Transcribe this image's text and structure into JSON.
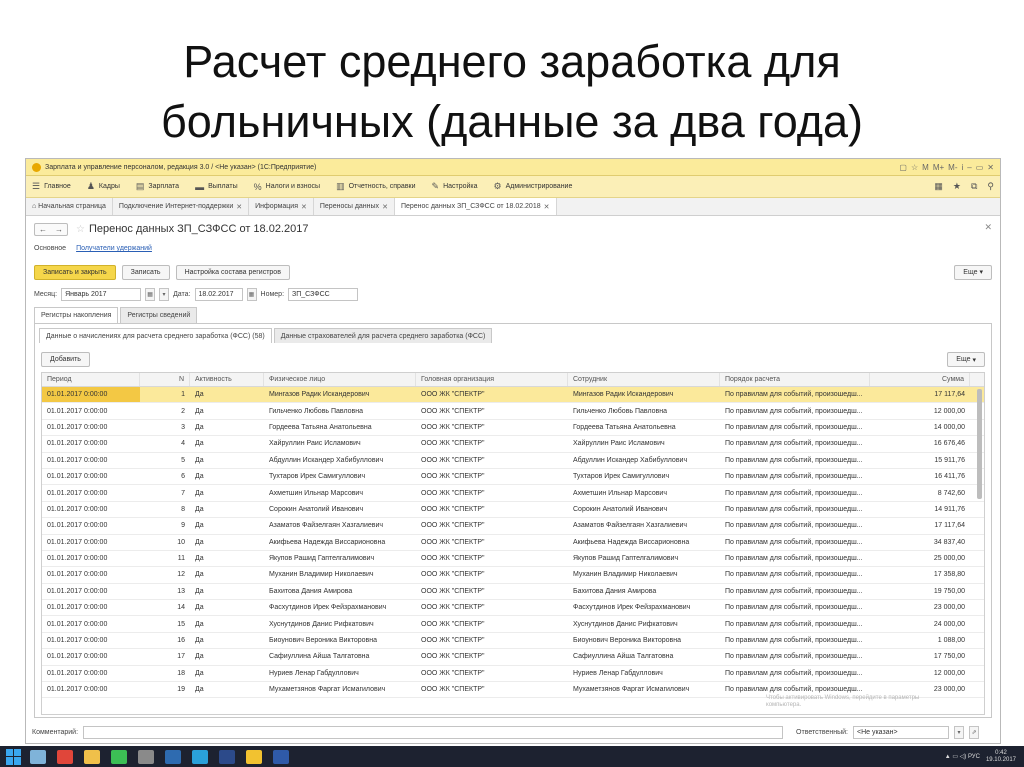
{
  "slide": {
    "title_line1": "Расчет среднего заработка для",
    "title_line2": "больничных (данные за два года)"
  },
  "window": {
    "title": "Зарплата и управление персоналом, редакция 3.0 / <Не указан> (1С:Предприятие)",
    "tools": [
      "▢",
      "☆",
      "М",
      "М+",
      "М-",
      "i",
      "–",
      "▭",
      "✕"
    ]
  },
  "menu": {
    "items": [
      {
        "icon": "☰",
        "label": "Главное"
      },
      {
        "icon": "♟",
        "label": "Кадры"
      },
      {
        "icon": "▤",
        "label": "Зарплата"
      },
      {
        "icon": "▬",
        "label": "Выплаты"
      },
      {
        "icon": "%",
        "label": "Налоги и взносы"
      },
      {
        "icon": "▥",
        "label": "Отчетность, справки"
      },
      {
        "icon": "✎",
        "label": "Настройка"
      },
      {
        "icon": "⚙",
        "label": "Администрирование"
      }
    ],
    "right_icons": [
      "▦",
      "★",
      "⧉",
      "⚲"
    ]
  },
  "open_tabs": [
    {
      "label": "⌂ Начальная страница",
      "closable": false
    },
    {
      "label": "Подключение Интернет-поддержки",
      "closable": true
    },
    {
      "label": "Информация",
      "closable": true
    },
    {
      "label": "Переносы данных",
      "closable": true
    },
    {
      "label": "Перенос данных ЗП_СЗФСС от 18.02.2018",
      "closable": true
    }
  ],
  "document": {
    "nav_back": "←",
    "nav_fwd": "→",
    "star": "☆",
    "title": "Перенос данных ЗП_СЗФСС от 18.02.2017",
    "close": "✕",
    "link_main": "Основное",
    "link_recipients": "Получатели удержаний"
  },
  "toolbar": {
    "save_close": "Записать и закрыть",
    "save": "Записать",
    "registers": "Настройка состава регистров",
    "more": "Еще"
  },
  "fields": {
    "month_label": "Месяц:",
    "month_value": "Январь 2017",
    "date_label": "Дата:",
    "date_value": "18.02.2017",
    "number_label": "Номер:",
    "number_value": "ЗП_СЗФСС"
  },
  "section_tabs": [
    "Регистры накопления",
    "Регистры сведений"
  ],
  "sub_tabs": [
    "Данные о начислениях для расчета среднего заработка (ФСС) (58)",
    "Данные страхователей для расчета среднего заработка (ФСС)"
  ],
  "table_toolbar": {
    "add": "Добавить",
    "more": "Еще"
  },
  "table": {
    "columns": [
      "Период",
      "N",
      "Активность",
      "Физическое лицо",
      "Головная организация",
      "Сотрудник",
      "Порядок расчета",
      "Сумма"
    ],
    "rows": [
      [
        "01.01.2017 0:00:00",
        "1",
        "Да",
        "Мингазов Радик Искандерович",
        "ООО ЖК \"СПЕКТР\"",
        "Мингазов Радик Искандерович",
        "По правилам для событий, произошедш...",
        "17 117,64"
      ],
      [
        "01.01.2017 0:00:00",
        "2",
        "Да",
        "Гильченко Любовь Павловна",
        "ООО ЖК \"СПЕКТР\"",
        "Гильченко Любовь Павловна",
        "По правилам для событий, произошедш...",
        "12 000,00"
      ],
      [
        "01.01.2017 0:00:00",
        "3",
        "Да",
        "Гордеева Татьяна Анатольевна",
        "ООО ЖК \"СПЕКТР\"",
        "Гордеева Татьяна Анатольевна",
        "По правилам для событий, произошедш...",
        "14 000,00"
      ],
      [
        "01.01.2017 0:00:00",
        "4",
        "Да",
        "Хайруллин Раис Исламович",
        "ООО ЖК \"СПЕКТР\"",
        "Хайруллин Раис Исламович",
        "По правилам для событий, произошедш...",
        "16 676,46"
      ],
      [
        "01.01.2017 0:00:00",
        "5",
        "Да",
        "Абдуллин Искандер Хабибуллович",
        "ООО ЖК \"СПЕКТР\"",
        "Абдуллин Искандер Хабибуллович",
        "По правилам для событий, произошедш...",
        "15 911,76"
      ],
      [
        "01.01.2017 0:00:00",
        "6",
        "Да",
        "Тухтаров Ирек Самигуллович",
        "ООО ЖК \"СПЕКТР\"",
        "Тухтаров Ирек Самигуллович",
        "По правилам для событий, произошедш...",
        "16 411,76"
      ],
      [
        "01.01.2017 0:00:00",
        "7",
        "Да",
        "Ахметшин Ильнар Марсович",
        "ООО ЖК \"СПЕКТР\"",
        "Ахметшин Ильнар Марсович",
        "По правилам для событий, произошедш...",
        "8 742,60"
      ],
      [
        "01.01.2017 0:00:00",
        "8",
        "Да",
        "Сорокин Анатолий Иванович",
        "ООО ЖК \"СПЕКТР\"",
        "Сорокин Анатолий Иванович",
        "По правилам для событий, произошедш...",
        "14 911,76"
      ],
      [
        "01.01.2017 0:00:00",
        "9",
        "Да",
        "Азаматов Файзелгаян Хазгалиевич",
        "ООО ЖК \"СПЕКТР\"",
        "Азаматов Файзелгаян Хазгалиевич",
        "По правилам для событий, произошедш...",
        "17 117,64"
      ],
      [
        "01.01.2017 0:00:00",
        "10",
        "Да",
        "Акифьева Надежда Виссарионовна",
        "ООО ЖК \"СПЕКТР\"",
        "Акифьева Надежда Виссарионовна",
        "По правилам для событий, произошедш...",
        "34 837,40"
      ],
      [
        "01.01.2017 0:00:00",
        "11",
        "Да",
        "Якупов Рашид Гаптелгалимович",
        "ООО ЖК \"СПЕКТР\"",
        "Якупов Рашид Гаптелгалимович",
        "По правилам для событий, произошедш...",
        "25 000,00"
      ],
      [
        "01.01.2017 0:00:00",
        "12",
        "Да",
        "Муханин Владимир Николаевич",
        "ООО ЖК \"СПЕКТР\"",
        "Муханин Владимир Николаевич",
        "По правилам для событий, произошедш...",
        "17 358,80"
      ],
      [
        "01.01.2017 0:00:00",
        "13",
        "Да",
        "Бахитова Дания Амирова",
        "ООО ЖК \"СПЕКТР\"",
        "Бахитова Дания Амирова",
        "По правилам для событий, произошедш...",
        "19 750,00"
      ],
      [
        "01.01.2017 0:00:00",
        "14",
        "Да",
        "Фасхутдинов Ирек Фейзрахманович",
        "ООО ЖК \"СПЕКТР\"",
        "Фасхутдинов Ирек Фейзрахманович",
        "По правилам для событий, произошедш...",
        "23 000,00"
      ],
      [
        "01.01.2017 0:00:00",
        "15",
        "Да",
        "Хуснутдинов Данис Рифкатович",
        "ООО ЖК \"СПЕКТР\"",
        "Хуснутдинов Данис Рифкатович",
        "По правилам для событий, произошедш...",
        "24 000,00"
      ],
      [
        "01.01.2017 0:00:00",
        "16",
        "Да",
        "Биоунович Вероника Викторовна",
        "ООО ЖК \"СПЕКТР\"",
        "Биоунович Вероника Викторовна",
        "По правилам для событий, произошедш...",
        "1 088,00"
      ],
      [
        "01.01.2017 0:00:00",
        "17",
        "Да",
        "Сафиуллина Айша Талгатовна",
        "ООО ЖК \"СПЕКТР\"",
        "Сафиуллина Айша Талгатовна",
        "По правилам для событий, произошедш...",
        "17 750,00"
      ],
      [
        "01.01.2017 0:00:00",
        "18",
        "Да",
        "Нуриев Ленар Габдуллович",
        "ООО ЖК \"СПЕКТР\"",
        "Нуриев Ленар Габдуллович",
        "По правилам для событий, произошедш...",
        "12 000,00"
      ],
      [
        "01.01.2017 0:00:00",
        "19",
        "Да",
        "Мухаметзянов Фаргат Исмагилович",
        "ООО ЖК \"СПЕКТР\"",
        "Мухаметзянов Фаргат Исмагилович",
        "По правилам для событий, произошедш...",
        "23 000,00"
      ]
    ],
    "selected_row": 0
  },
  "watermark": "Чтобы активировать Windows, перейдите в параметры компьютера.",
  "bottom": {
    "comment_label": "Комментарий:",
    "responsible_label": "Ответственный:",
    "responsible_value": "<Не указан>"
  },
  "taskbar": {
    "icons": [
      {
        "name": "file-explorer-icon",
        "color": "#7fb3d9"
      },
      {
        "name": "chrome-icon",
        "color": "#e0463a"
      },
      {
        "name": "explorer-icon",
        "color": "#f0c04a"
      },
      {
        "name": "whatsapp-icon",
        "color": "#3cbf55"
      },
      {
        "name": "app-icon",
        "color": "#8a8a8a"
      },
      {
        "name": "folder-icon",
        "color": "#2e6bb0"
      },
      {
        "name": "telegram-icon",
        "color": "#2aa1da"
      },
      {
        "name": "photoshop-icon",
        "color": "#2c4a8a"
      },
      {
        "name": "1c-icon",
        "color": "#f2c230"
      },
      {
        "name": "word-icon",
        "color": "#2f5aa8"
      }
    ],
    "tray": "▲ ▭ ◁) РУС",
    "time": "0:42",
    "date": "19.10.2017"
  }
}
